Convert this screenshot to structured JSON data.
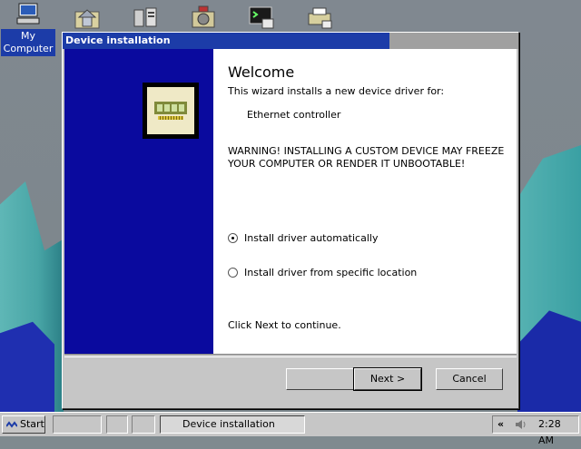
{
  "desktop": {
    "my_computer_label_1": "My",
    "my_computer_label_2": "Computer",
    "taskbar_icons": [
      "home-folder-icon",
      "devices-icon",
      "disk-tools-icon",
      "terminal-icon",
      "printer-icon"
    ]
  },
  "dialog": {
    "title": "Device installation",
    "heading": "Welcome",
    "intro": "This wizard installs a new device driver for:",
    "device_name": "Ethernet controller",
    "warning_line1": "WARNING! INSTALLING A CUSTOM DEVICE MAY FREEZE",
    "warning_line2": "YOUR COMPUTER OR RENDER IT UNBOOTABLE!",
    "options": [
      {
        "label": "Install driver automatically",
        "selected": true
      },
      {
        "label": "Install driver from specific location",
        "selected": false
      }
    ],
    "footer_hint": "Click Next to continue.",
    "next_label": "Next >",
    "cancel_label": "Cancel"
  },
  "taskbar": {
    "start_label": "Start",
    "active_task": "Device installation",
    "tray_chevron": "«",
    "clock": "2:28 AM"
  },
  "colors": {
    "title_active": "#1c3ca8",
    "left_pane": "#0a0a9e",
    "face": "#c6c6c6"
  }
}
